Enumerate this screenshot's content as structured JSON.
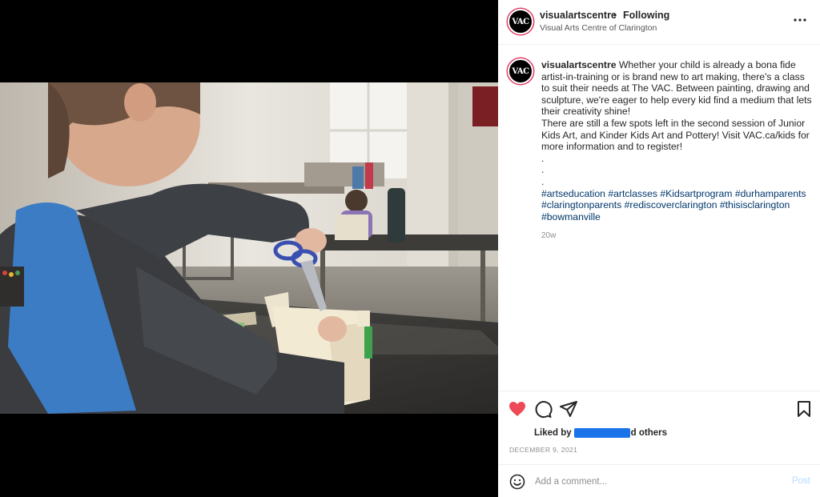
{
  "post": {
    "username": "visualartscentre",
    "separator": "•",
    "follow_status": "Following",
    "location": "Visual Arts Centre of Clarington",
    "avatar_text": "VAC"
  },
  "caption": {
    "username": "visualartscentre",
    "lines": [
      "Whether your child is already a bona fide artist-in-training or is brand new to art making, there's a class to suit their needs at The VAC. Between painting, drawing and sculpture, we're eager to help every kid find a medium that lets their creativity shine!",
      "There are still a few spots left in the second session of Junior Kids Art, and Kinder Kids Art and Pottery! Visit VAC.ca/kids for more information and to register!",
      ".",
      ".",
      "."
    ],
    "hashtags": "#artseducation #artclasses #Kidsartprogram #durhamparents #claringtonparents #rediscoverclarington #thisisclarington #bowmanville",
    "age": "20w"
  },
  "likes": {
    "prefix": "Liked by",
    "suffix": "d others"
  },
  "date": "DECEMBER 9, 2021",
  "comment": {
    "placeholder": "Add a comment...",
    "post_label": "Post"
  },
  "icons": {
    "like": "heart-icon",
    "comment": "comment-icon",
    "share": "share-icon",
    "save": "bookmark-icon",
    "more": "more-horizontal-icon",
    "emoji": "emoji-icon"
  },
  "colors": {
    "heart": "#ed4956",
    "hashtag": "#00376b",
    "post_button": "#b3dbff",
    "redaction": "#1a73e8"
  }
}
